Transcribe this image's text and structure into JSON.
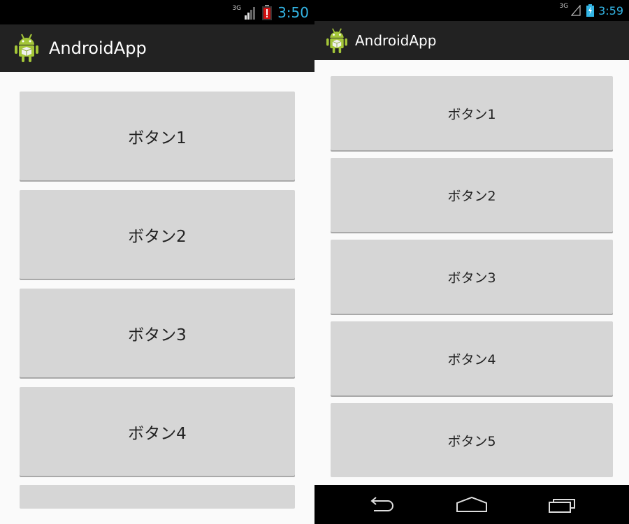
{
  "left_screen": {
    "status": {
      "network": "3G",
      "time": "3:50"
    },
    "app_title": "AndroidApp",
    "buttons": [
      "ボタン1",
      "ボタン2",
      "ボタン3",
      "ボタン4",
      ""
    ]
  },
  "right_screen": {
    "status": {
      "network": "3G",
      "time": "3:59"
    },
    "app_title": "AndroidApp",
    "buttons": [
      "ボタン1",
      "ボタン2",
      "ボタン3",
      "ボタン4",
      "ボタン5"
    ]
  },
  "colors": {
    "status_time": "#33b5e5",
    "actionbar": "#222222",
    "button_bg": "#d6d6d6",
    "screen_bg": "#fafafa",
    "battery_alert": "#d01010",
    "android_green": "#a4c639"
  },
  "icons": [
    "android-app-icon",
    "signal-icon",
    "battery-alert-icon",
    "battery-charging-icon",
    "back-icon",
    "home-icon",
    "recent-apps-icon"
  ]
}
